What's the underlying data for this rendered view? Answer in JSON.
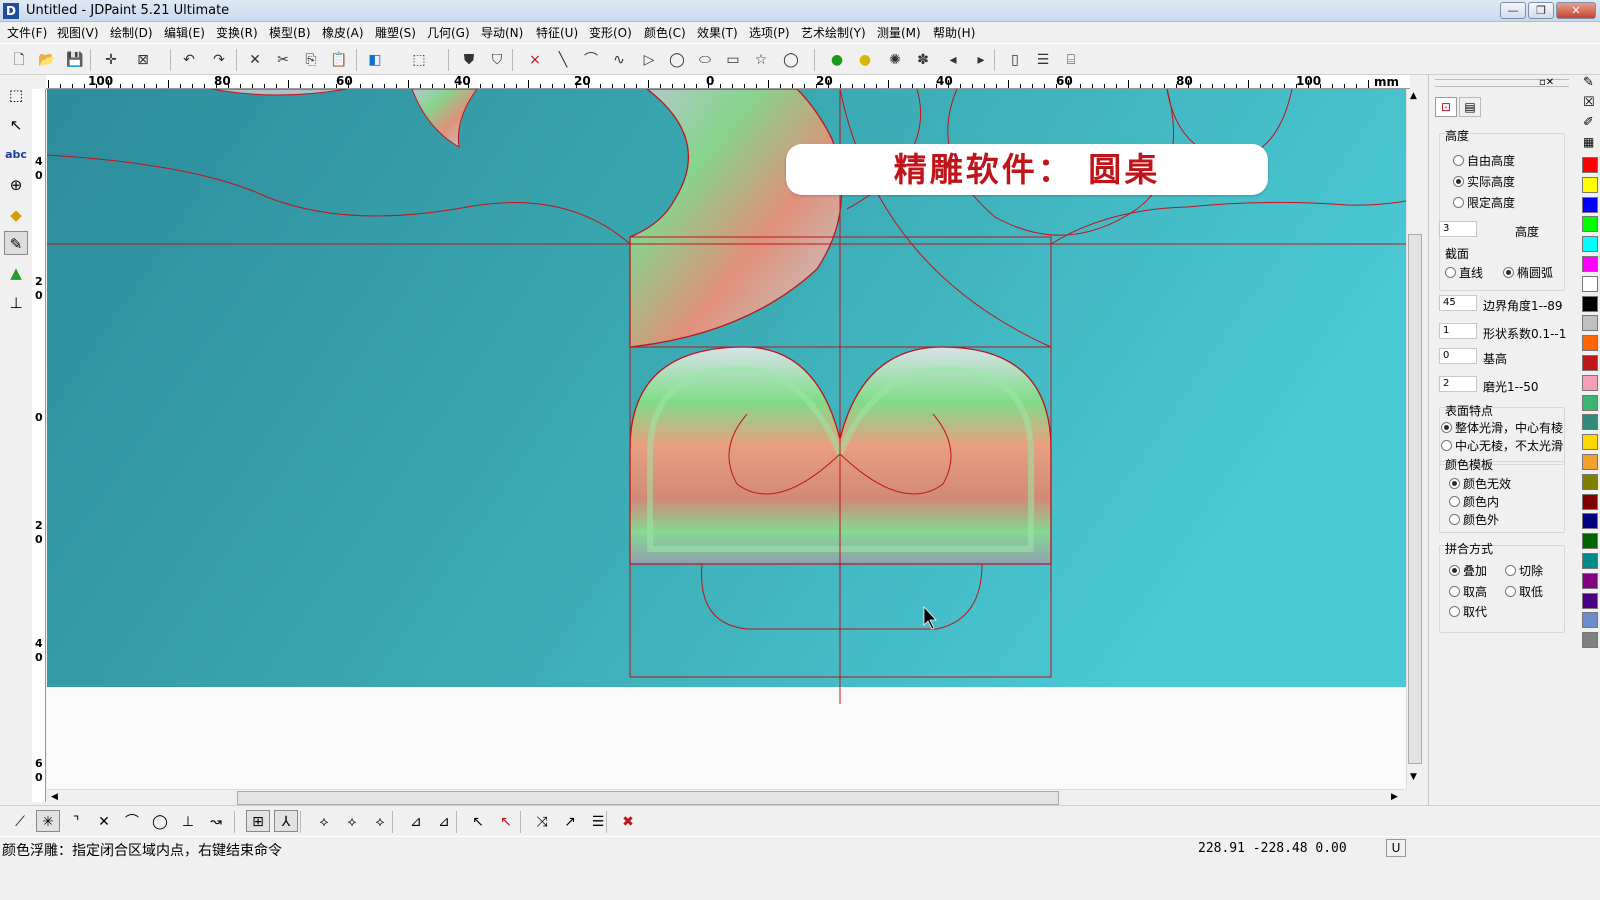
{
  "window": {
    "title": "Untitled - JDPaint 5.21 Ultimate",
    "app_icon": "D",
    "controls": {
      "minimize": "—",
      "maximize": "❐",
      "close": "✕"
    }
  },
  "menu": [
    "文件(F)",
    "视图(V)",
    "绘制(D)",
    "编辑(E)",
    "变换(R)",
    "模型(B)",
    "橡皮(A)",
    "雕塑(S)",
    "几何(G)",
    "导动(N)",
    "特征(U)",
    "变形(O)",
    "颜色(C)",
    "效果(T)",
    "选项(P)",
    "艺术绘制(Y)",
    "测量(M)",
    "帮助(H)"
  ],
  "toolbar_icons": [
    "new-file-icon",
    "open-folder-icon",
    "save-icon",
    "crosshair-icon",
    "select-box-icon",
    "undo-icon",
    "redo-icon",
    "delete-icon",
    "cut-icon",
    "copy-icon",
    "paste-icon",
    "layer-color-icon",
    "view-3d-icon",
    "shield-icon",
    "shield-filled-icon",
    "point-icon",
    "line-icon",
    "arc-icon",
    "curve-icon",
    "polygon-icon",
    "circle-icon",
    "ellipse-icon",
    "rectangle-icon",
    "star-icon",
    "large-circle-icon",
    "light-green-icon",
    "light-yellow-icon",
    "lights-icon",
    "material-icon",
    "prev-icon",
    "next-icon",
    "book-icon",
    "grid-icon",
    "mesh-icon"
  ],
  "ruler": {
    "labels": [
      "100",
      "80",
      "60",
      "40",
      "20",
      "0",
      "20",
      "40",
      "60",
      "80",
      "100"
    ],
    "unit": "mm",
    "vertical_labels": [
      "4\n0",
      "2\n0",
      "0",
      "2\n0",
      "4\n0",
      "6\n0"
    ]
  },
  "banner": {
    "text": "精雕软件： 圆桌"
  },
  "right_panel": {
    "height_group": "高度",
    "height_options": [
      {
        "label": "自由高度",
        "selected": false
      },
      {
        "label": "实际高度",
        "selected": true
      },
      {
        "label": "限定高度",
        "selected": false
      }
    ],
    "height_value": "3",
    "height_value_label": "高度",
    "section_group": "截面",
    "section_options": [
      {
        "label": "直线",
        "selected": false
      },
      {
        "label": "椭圆弧",
        "selected": true
      }
    ],
    "params": [
      {
        "value": "45",
        "label": "边界角度1--89"
      },
      {
        "value": "1",
        "label": "形状系数0.1--1"
      },
      {
        "value": "0",
        "label": "基高"
      },
      {
        "value": "2",
        "label": "磨光1--50"
      }
    ],
    "surface_group": "表面特点",
    "surface_options": [
      {
        "label": "整体光滑，中心有棱",
        "selected": true
      },
      {
        "label": "中心无棱，不太光滑",
        "selected": false
      }
    ],
    "color_template_group": "颜色模板",
    "color_template_options": [
      {
        "label": "颜色无效",
        "selected": true
      },
      {
        "label": "颜色内",
        "selected": false
      },
      {
        "label": "颜色外",
        "selected": false
      }
    ],
    "combine_group": "拼合方式",
    "combine_options": [
      {
        "label": "叠加",
        "selected": true
      },
      {
        "label": "切除",
        "selected": false
      },
      {
        "label": "取高",
        "selected": false
      },
      {
        "label": "取低",
        "selected": false
      },
      {
        "label": "取代",
        "selected": false
      }
    ]
  },
  "palette": [
    "#ff0000",
    "#ffff00",
    "#0000ff",
    "#00ff00",
    "#00ffff",
    "#ff00ff",
    "#ffffff",
    "#000000",
    "#c0c0c0",
    "#ff6600",
    "#c01818",
    "#f5a0b8",
    "#3cb371",
    "#2e8b7a",
    "#ffd700",
    "#f0a030",
    "#808000",
    "#800000",
    "#000080",
    "#006400",
    "#008b8b",
    "#800080",
    "#4b0082",
    "#6a8cc8",
    "#808080"
  ],
  "status": {
    "message": "颜色浮雕：指定闭合区域内点，右键结束命令",
    "coords": "228.91  -228.48  0.00",
    "mode": "U"
  },
  "colors": {
    "canvas_bg": "#3aa8b0",
    "curve": "#c0141b",
    "banner_text": "#c0141b"
  }
}
